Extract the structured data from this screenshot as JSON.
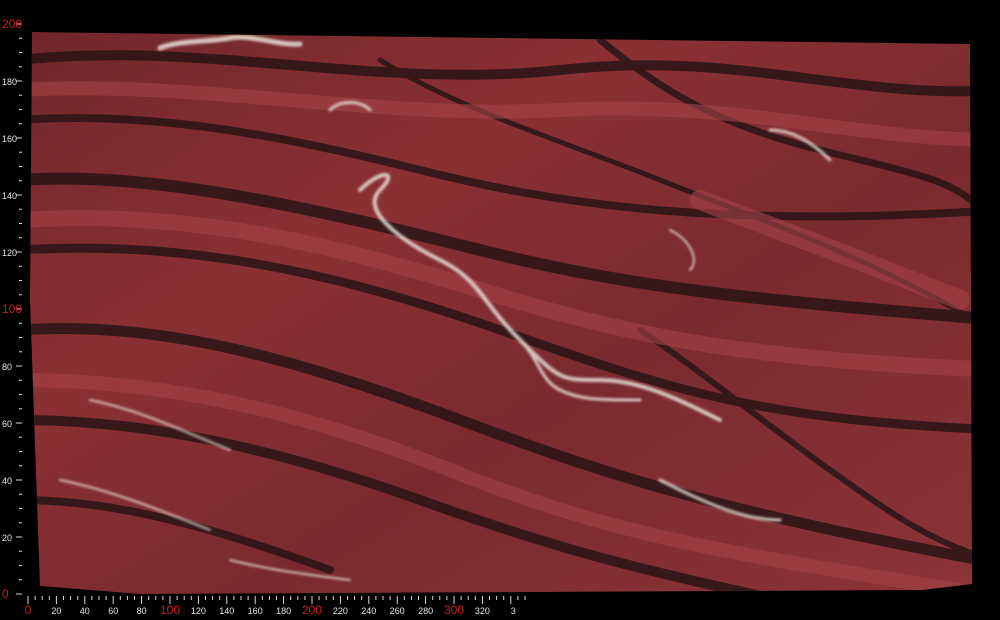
{
  "ruler": {
    "x_labels": [
      "0",
      "20",
      "40",
      "60",
      "80",
      "100",
      "120",
      "140",
      "160",
      "180",
      "200",
      "220",
      "240",
      "260",
      "280",
      "300",
      "320",
      "3"
    ],
    "y_labels": [
      "200",
      "180",
      "160",
      "140",
      "120",
      "100",
      "80",
      "60",
      "40",
      "20",
      "0"
    ],
    "highlight_labels": [
      "0",
      "100",
      "200",
      "300"
    ],
    "colors": {
      "highlight": "#d21a1a",
      "normal": "#e6e6e6",
      "tick": "#d8d8d8"
    }
  },
  "slab": {
    "material": "red quartzite / marble slab",
    "colors": {
      "base": "#7a2a2e",
      "dark_vein": "#2a1517",
      "mid_red": "#9b3a3c",
      "light_vein": "#e8e2d8",
      "background": "#000000"
    }
  }
}
